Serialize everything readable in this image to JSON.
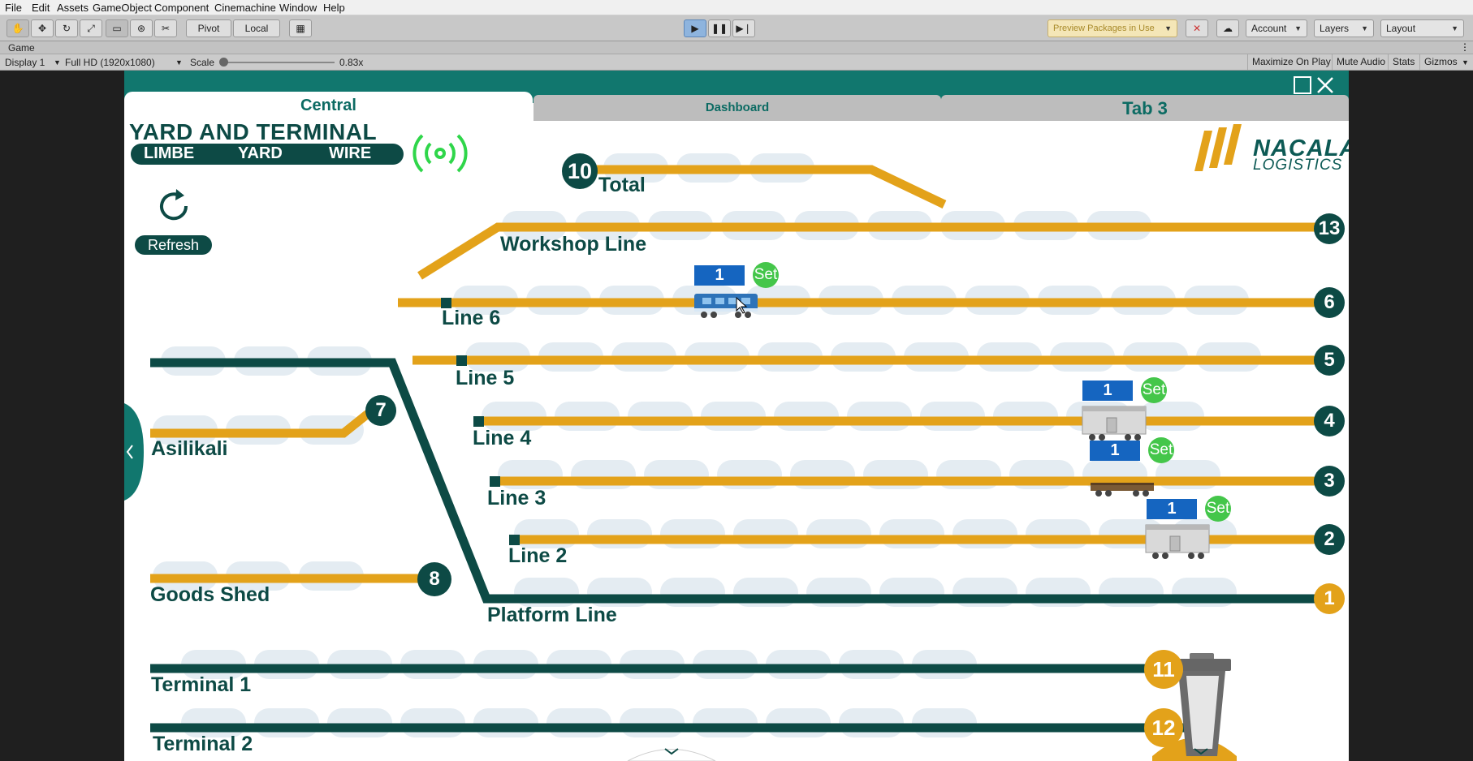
{
  "menu": [
    "File",
    "Edit",
    "Assets",
    "GameObject",
    "Component",
    "Cinemachine",
    "Window",
    "Help"
  ],
  "toolbar": {
    "pivot_label": "Pivot",
    "local_label": "Local",
    "preview_packages": "Preview Packages in Use",
    "account": "Account",
    "layers": "Layers",
    "layout": "Layout"
  },
  "game_tab": {
    "label": "Game"
  },
  "game_bar": {
    "display": "Display 1",
    "resolution": "Full HD (1920x1080)",
    "scale_label": "Scale",
    "scale_value": "0.83x",
    "maximize": "Maximize On Play",
    "mute": "Mute Audio",
    "stats": "Stats",
    "gizmos": "Gizmos"
  },
  "tabs": {
    "central": "Central",
    "dashboard": "Dashboard",
    "tab3": "Tab 3"
  },
  "header": {
    "title": "YARD AND TERMINAL",
    "subtitle": [
      "LIMBE",
      "YARD",
      "WIRE"
    ],
    "refresh": "Refresh"
  },
  "logo": {
    "line1": "NACALA",
    "line2": "LOGISTICS"
  },
  "lines": {
    "total": {
      "label": "Total",
      "number": "10"
    },
    "workshop": {
      "label": "Workshop Line",
      "number": "13"
    },
    "line6": {
      "label": "Line 6",
      "number": "6"
    },
    "line5": {
      "label": "Line 5",
      "number": "5"
    },
    "line4": {
      "label": "Line 4",
      "number": "4"
    },
    "line3": {
      "label": "Line 3",
      "number": "3"
    },
    "line2": {
      "label": "Line 2",
      "number": "2"
    },
    "platform": {
      "label": "Platform Line",
      "number": "1"
    },
    "asilikali": {
      "label": "Asilikali",
      "number": "7"
    },
    "goods": {
      "label": "Goods Shed",
      "number": "8"
    },
    "terminal1": {
      "label": "Terminal 1",
      "number": "11"
    },
    "terminal2": {
      "label": "Terminal 2",
      "number": "12"
    }
  },
  "wagons": [
    {
      "line": "Line 6",
      "count": "1",
      "set": "Set"
    },
    {
      "line": "Line 4",
      "count": "1",
      "set": "Set"
    },
    {
      "line": "Line 3",
      "count": "1",
      "set": "Set"
    },
    {
      "line": "Line 2",
      "count": "1",
      "set": "Set"
    }
  ],
  "colors": {
    "teal": "#11776e",
    "dark_green": "#0d4a45",
    "gold": "#e3a21a",
    "blue": "#1565c0",
    "set_green": "#44c64a"
  }
}
